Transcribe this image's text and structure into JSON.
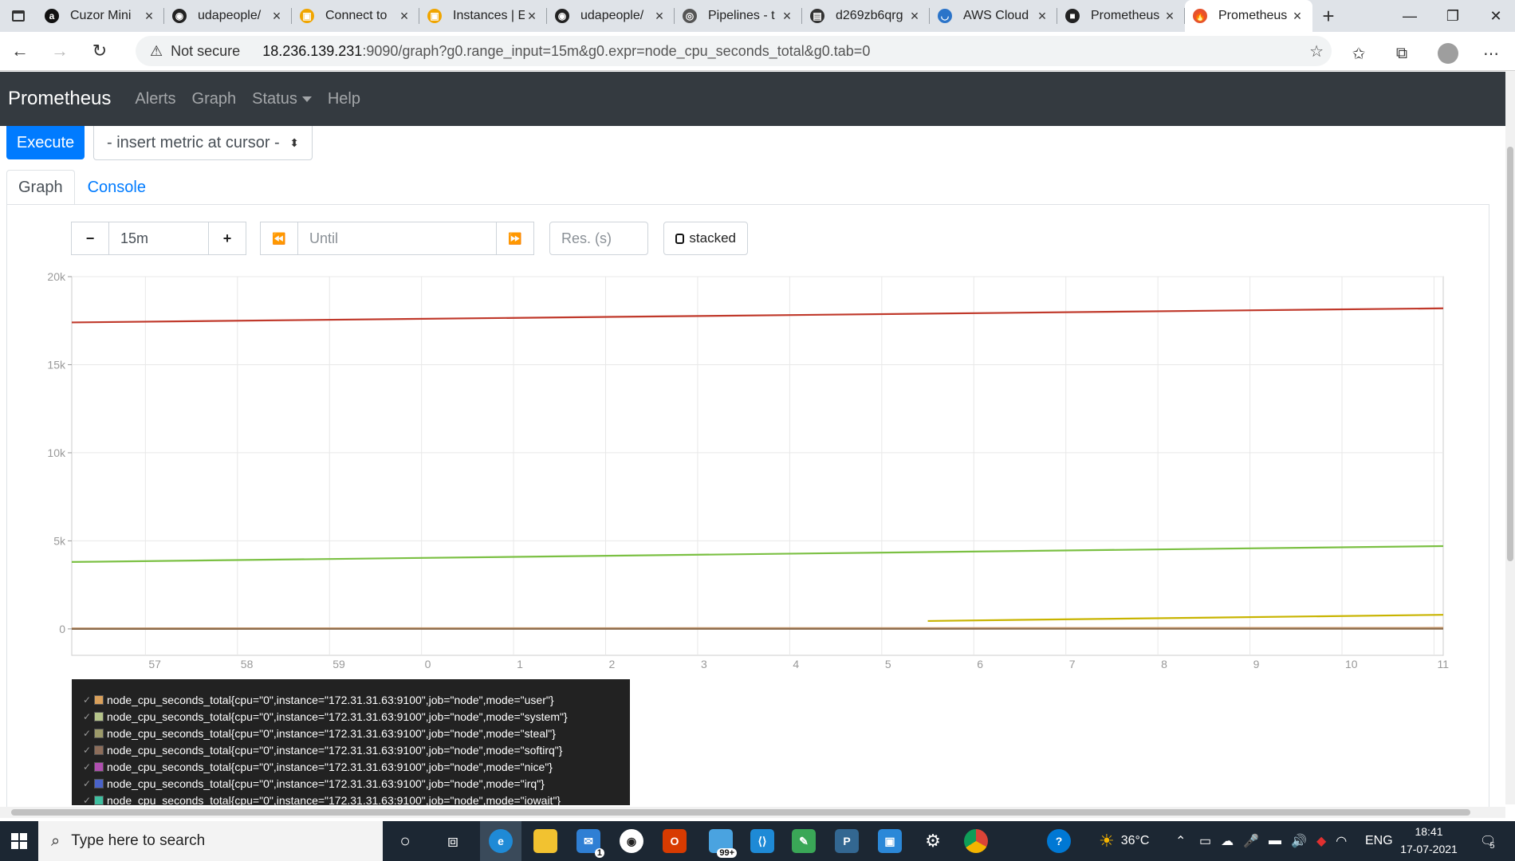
{
  "browser": {
    "tabs": [
      {
        "label": "Cuzor Mini",
        "icon": "amazon-icon",
        "color": "#111111"
      },
      {
        "label": "udapeople/",
        "icon": "github-icon",
        "color": "#222222"
      },
      {
        "label": "Connect to",
        "icon": "aws-box-icon",
        "color": "#f0a500"
      },
      {
        "label": "Instances | E",
        "icon": "aws-box-icon",
        "color": "#f0a500"
      },
      {
        "label": "udapeople/",
        "icon": "github-icon",
        "color": "#222222"
      },
      {
        "label": "Pipelines - t",
        "icon": "circleci-icon",
        "color": "#555555"
      },
      {
        "label": "d269zb6qrg",
        "icon": "file-icon",
        "color": "#333333"
      },
      {
        "label": "AWS Cloud",
        "icon": "cloud9-icon",
        "color": "#2b74c9"
      },
      {
        "label": "Prometheus",
        "icon": "terminal-icon",
        "color": "#222222"
      },
      {
        "label": "Prometheus",
        "icon": "prometheus-icon",
        "color": "#e6522c"
      }
    ],
    "not_secure": "Not secure",
    "url_host": "18.236.139.231",
    "url_path": ":9090/graph?g0.range_input=15m&g0.expr=node_cpu_seconds_total&g0.tab=0"
  },
  "nav": {
    "brand": "Prometheus",
    "links": [
      "Alerts",
      "Graph",
      "Status",
      "Help"
    ]
  },
  "query": {
    "execute_label": "Execute",
    "metric_select": "- insert metric at cursor -"
  },
  "tabs": {
    "graph": "Graph",
    "console": "Console"
  },
  "controls": {
    "minus": "−",
    "range": "15m",
    "plus": "+",
    "back": "⏪",
    "until_placeholder": "Until",
    "forward": "⏩",
    "res_placeholder": "Res. (s)",
    "stacked_label": "stacked"
  },
  "chart_data": {
    "type": "line",
    "y_ticks": [
      "0",
      "5k",
      "10k",
      "15k",
      "20k"
    ],
    "ylim": [
      -1500,
      20000
    ],
    "x_ticks": [
      "57",
      "58",
      "59",
      "0",
      "1",
      "2",
      "3",
      "4",
      "5",
      "6",
      "7",
      "8",
      "9",
      "10",
      "11"
    ],
    "x_tick_values": [
      57,
      58,
      59,
      60,
      61,
      62,
      63,
      64,
      65,
      66,
      67,
      68,
      69,
      70,
      71
    ],
    "xlim": [
      56.2,
      71.1
    ],
    "grid": true,
    "series": [
      {
        "color": "#c0392b",
        "x": [
          56.2,
          71.1
        ],
        "y": [
          17400,
          18200
        ]
      },
      {
        "color": "#7bc043",
        "x": [
          56.2,
          71.1
        ],
        "y": [
          3800,
          4700
        ]
      },
      {
        "color": "#c8b400",
        "x": [
          65.5,
          71.1
        ],
        "y": [
          450,
          800
        ]
      },
      {
        "color": "#d4a373",
        "x": [
          56.2,
          71.1
        ],
        "y": [
          30,
          60
        ]
      },
      {
        "color": "#8c6d4f",
        "x": [
          56.2,
          71.1
        ],
        "y": [
          0,
          10
        ]
      }
    ]
  },
  "legend": [
    {
      "label": "node_cpu_seconds_total{cpu=\"0\",instance=\"172.31.31.63:9100\",job=\"node\",mode=\"user\"}",
      "color": "#d9a05b"
    },
    {
      "label": "node_cpu_seconds_total{cpu=\"0\",instance=\"172.31.31.63:9100\",job=\"node\",mode=\"system\"}",
      "color": "#b5c48a"
    },
    {
      "label": "node_cpu_seconds_total{cpu=\"0\",instance=\"172.31.31.63:9100\",job=\"node\",mode=\"steal\"}",
      "color": "#9c9a6a"
    },
    {
      "label": "node_cpu_seconds_total{cpu=\"0\",instance=\"172.31.31.63:9100\",job=\"node\",mode=\"softirq\"}",
      "color": "#8c6d5a"
    },
    {
      "label": "node_cpu_seconds_total{cpu=\"0\",instance=\"172.31.31.63:9100\",job=\"node\",mode=\"nice\"}",
      "color": "#b04fb0"
    },
    {
      "label": "node_cpu_seconds_total{cpu=\"0\",instance=\"172.31.31.63:9100\",job=\"node\",mode=\"irq\"}",
      "color": "#4a63c9"
    },
    {
      "label": "node_cpu_seconds_total{cpu=\"0\",instance=\"172.31.31.63:9100\",job=\"node\",mode=\"iowait\"}",
      "color": "#3fbfa0"
    }
  ],
  "taskbar": {
    "search_placeholder": "Type here to search",
    "mail_badge": "1",
    "files_badge": "99+",
    "temperature": "36°C",
    "language": "ENG",
    "time": "18:41",
    "date": "17-07-2021",
    "notif_count": "5"
  }
}
